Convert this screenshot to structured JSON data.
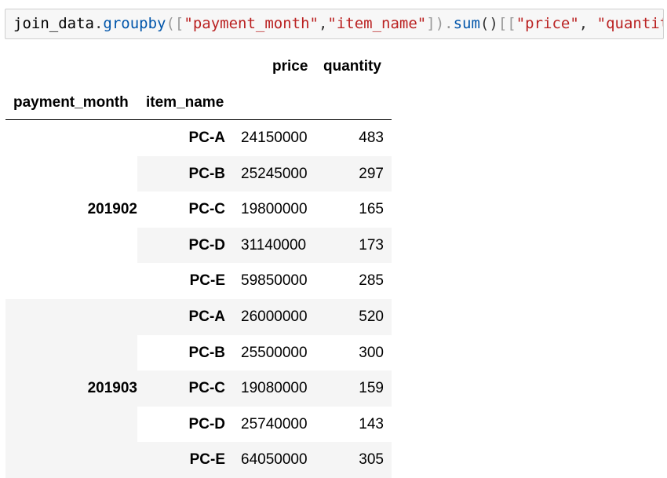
{
  "code": {
    "var": "join_data",
    "dot": ".",
    "fn1": "groupby",
    "open": "([",
    "arg1": "\"payment_month\"",
    "comma": ",",
    "arg2": "\"item_name\"",
    "close": "]).",
    "fn2": "sum",
    "call": "()",
    "sel_open": "[[",
    "sel1": "\"price\"",
    "sel_comma": ", ",
    "sel2": "\"quantity\"",
    "sel_close": "]]"
  },
  "table": {
    "col_headers": {
      "price": "price",
      "quantity": "quantity"
    },
    "index_headers": {
      "payment_month": "payment_month",
      "item_name": "item_name"
    },
    "groups": [
      {
        "month": "201902",
        "rows": [
          {
            "item": "PC-A",
            "price": "24150000",
            "quantity": "483"
          },
          {
            "item": "PC-B",
            "price": "25245000",
            "quantity": "297"
          },
          {
            "item": "PC-C",
            "price": "19800000",
            "quantity": "165"
          },
          {
            "item": "PC-D",
            "price": "31140000",
            "quantity": "173"
          },
          {
            "item": "PC-E",
            "price": "59850000",
            "quantity": "285"
          }
        ]
      },
      {
        "month": "201903",
        "rows": [
          {
            "item": "PC-A",
            "price": "26000000",
            "quantity": "520"
          },
          {
            "item": "PC-B",
            "price": "25500000",
            "quantity": "300"
          },
          {
            "item": "PC-C",
            "price": "19080000",
            "quantity": "159"
          },
          {
            "item": "PC-D",
            "price": "25740000",
            "quantity": "143"
          },
          {
            "item": "PC-E",
            "price": "64050000",
            "quantity": "305"
          }
        ]
      }
    ]
  }
}
